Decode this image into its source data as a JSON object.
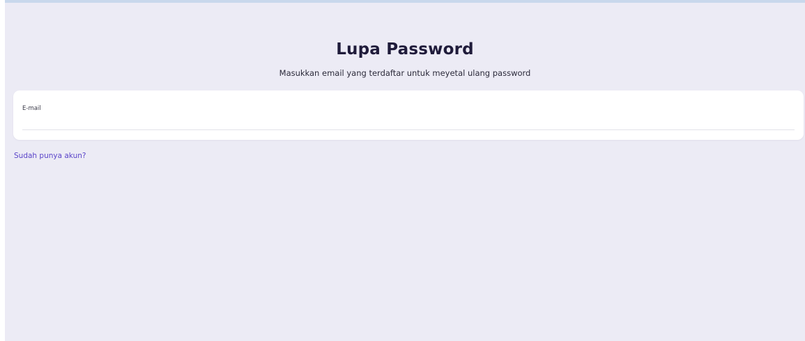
{
  "page": {
    "title": "Lupa Password",
    "subtitle": "Masukkan email yang terdaftar untuk meyetal ulang password"
  },
  "form": {
    "email_label": "E-mail",
    "email_value": "",
    "email_placeholder": ""
  },
  "links": {
    "login_link": "Sudah punya akun?"
  },
  "colors": {
    "background": "#ecebf5",
    "card": "#ffffff",
    "link": "#5a44c9",
    "title": "#1f1b3a"
  }
}
